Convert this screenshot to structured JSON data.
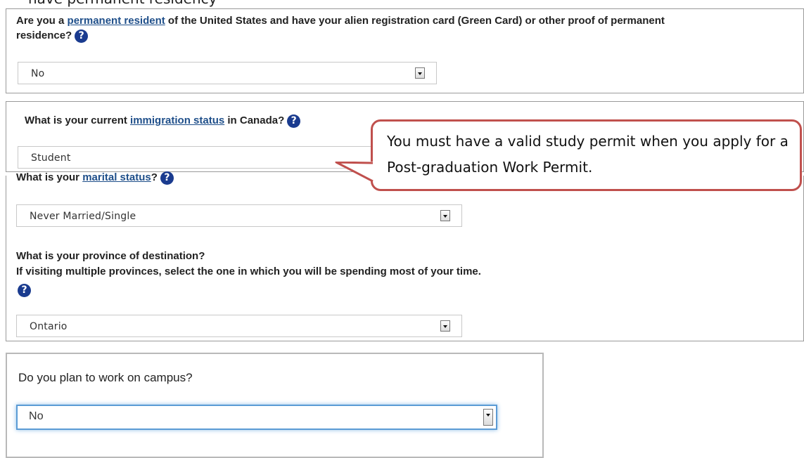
{
  "top_clip_text": "have permanent residency",
  "q_permanent": {
    "pre": "Are you a ",
    "link": "permanent resident",
    "post": " of the United States and have your alien registration card (Green Card) or other proof of permanent",
    "line2": "residence?",
    "value": "No"
  },
  "q_immigration": {
    "pre": "What is your current ",
    "link": "immigration status",
    "post": " in Canada?",
    "value": "Student"
  },
  "callout": {
    "text": "You must have a valid study permit when you apply for a Post-graduation Work Permit.",
    "border_color": "#c0504d"
  },
  "q_marital": {
    "pre": "What is your ",
    "link": "marital status",
    "post": "?",
    "value": "Never Married/Single"
  },
  "q_province": {
    "line1": "What is your province of destination?",
    "line2": "If visiting multiple provinces, select the one in which you will be spending most of your time.",
    "value": "Ontario"
  },
  "q_campus": {
    "label": "Do you plan to work on campus?",
    "value": "No"
  },
  "help_icon_glyph": "?",
  "colors": {
    "link": "#1f4f8a",
    "help_icon": "#1a3b8f",
    "focus": "#5b9bd5"
  }
}
